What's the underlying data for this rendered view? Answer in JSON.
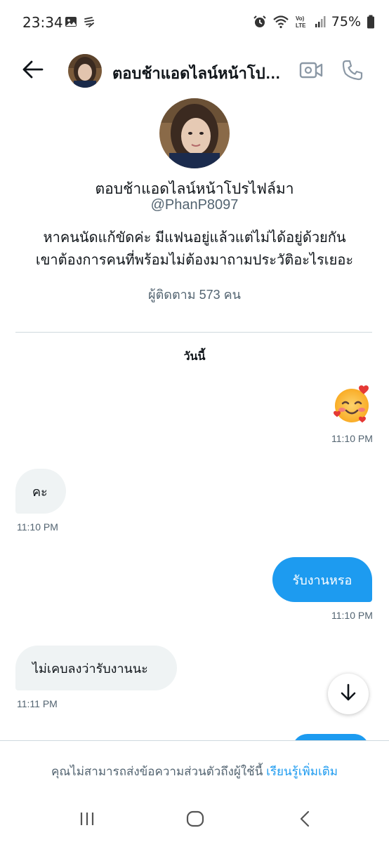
{
  "status_bar": {
    "time": "23:34",
    "battery": "75%",
    "icons": [
      "gallery-icon",
      "weather-icon",
      "alarm-icon",
      "wifi-icon",
      "volte-icon",
      "signal-icon",
      "battery-icon"
    ]
  },
  "header": {
    "title": "ตอบช้าแอดไลน์หน้าโปรไฟล์มา",
    "icons": [
      "back-arrow-icon",
      "video-call-icon",
      "phone-icon"
    ]
  },
  "profile": {
    "name": "ตอบช้าแอดไลน์หน้าโปรไฟล์มา",
    "handle": "@PhanP8097",
    "bio_line1": "หาคนนัดแก้ขัดค่ะ มีแฟนอยู่แล้วแต่ไม่ได้อยู่ด้วยกัน",
    "bio_line2": "เขาต้องการคนที่พร้อมไม่ต้องมาถามประวัติอะไรเยอะ",
    "followers": "ผู้ติดตาม 573 คน"
  },
  "conversation": {
    "day_label": "วันนี้",
    "messages": [
      {
        "direction": "out",
        "text": "🥰",
        "time": "11:10 PM"
      },
      {
        "direction": "in",
        "text": "คะ",
        "time": "11:10 PM"
      },
      {
        "direction": "out",
        "text": "รับงานหรอ",
        "time": "11:10 PM"
      },
      {
        "direction": "in",
        "text": "ไม่เคบลงว่ารับงานนะ",
        "time": "11:11 PM"
      }
    ]
  },
  "footer": {
    "notice": "คุณไม่สามารถส่งข้อความส่วนตัวถึงผู้ใช้นี้",
    "learn_more": "เรียนรู้เพิ่มเติม"
  },
  "colors": {
    "accent": "#1d9bf0",
    "bubble_in": "#eff3f4",
    "secondary_text": "#536471"
  }
}
